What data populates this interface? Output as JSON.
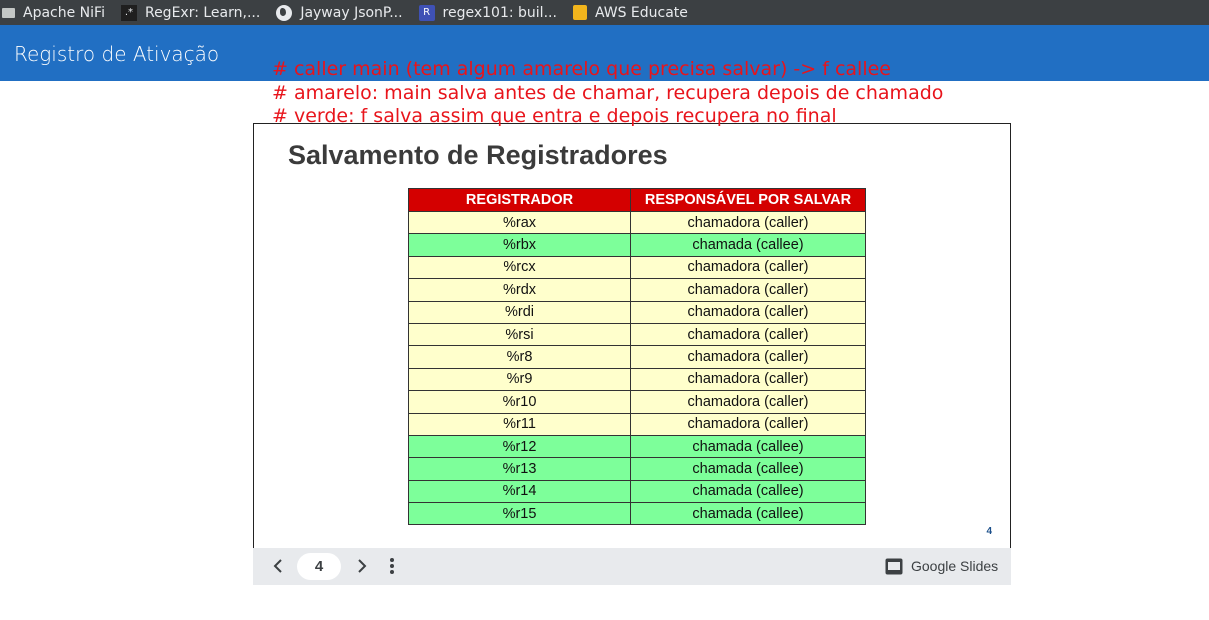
{
  "bookmarks": [
    {
      "icon": "folder-icon",
      "label": "Apache NiFi"
    },
    {
      "icon": "regexr-icon",
      "label": "RegExr: Learn,..."
    },
    {
      "icon": "globe-icon",
      "label": "Jayway JsonP..."
    },
    {
      "icon": "regex101-icon",
      "label": "regex101: buil..."
    },
    {
      "icon": "aws-icon",
      "label": "AWS Educate"
    }
  ],
  "header": {
    "title": "Registro de Ativação",
    "color": "#216fc3"
  },
  "comments": [
    "# caller main (tem algum amarelo que precisa salvar) -> f callee",
    "# amarelo: main salva antes de chamar, recupera depois de chamado",
    "# verde: f salva assim que entra e depois recupera no final"
  ],
  "slide": {
    "title": "Salvamento de Registradores",
    "page_number": "4",
    "table": {
      "headers": [
        "REGISTRADOR",
        "RESPONSÁVEL POR SALVAR"
      ],
      "rows": [
        {
          "reg": "%rax",
          "who": "chamadora (caller)",
          "type": "caller"
        },
        {
          "reg": "%rbx",
          "who": "chamada (callee)",
          "type": "callee"
        },
        {
          "reg": "%rcx",
          "who": "chamadora (caller)",
          "type": "caller"
        },
        {
          "reg": "%rdx",
          "who": "chamadora (caller)",
          "type": "caller"
        },
        {
          "reg": "%rdi",
          "who": "chamadora (caller)",
          "type": "caller"
        },
        {
          "reg": "%rsi",
          "who": "chamadora (caller)",
          "type": "caller"
        },
        {
          "reg": "%r8",
          "who": "chamadora (caller)",
          "type": "caller"
        },
        {
          "reg": "%r9",
          "who": "chamadora (caller)",
          "type": "caller"
        },
        {
          "reg": "%r10",
          "who": "chamadora (caller)",
          "type": "caller"
        },
        {
          "reg": "%r11",
          "who": "chamadora (caller)",
          "type": "caller"
        },
        {
          "reg": "%r12",
          "who": "chamada (callee)",
          "type": "callee"
        },
        {
          "reg": "%r13",
          "who": "chamada (callee)",
          "type": "callee"
        },
        {
          "reg": "%r14",
          "who": "chamada (callee)",
          "type": "callee"
        },
        {
          "reg": "%r15",
          "who": "chamada (callee)",
          "type": "callee"
        }
      ],
      "colors": {
        "header": "#d40000",
        "caller": "#ffffcc",
        "callee": "#7dff9a"
      }
    }
  },
  "controls": {
    "page": "4",
    "brand": "Google Slides"
  }
}
